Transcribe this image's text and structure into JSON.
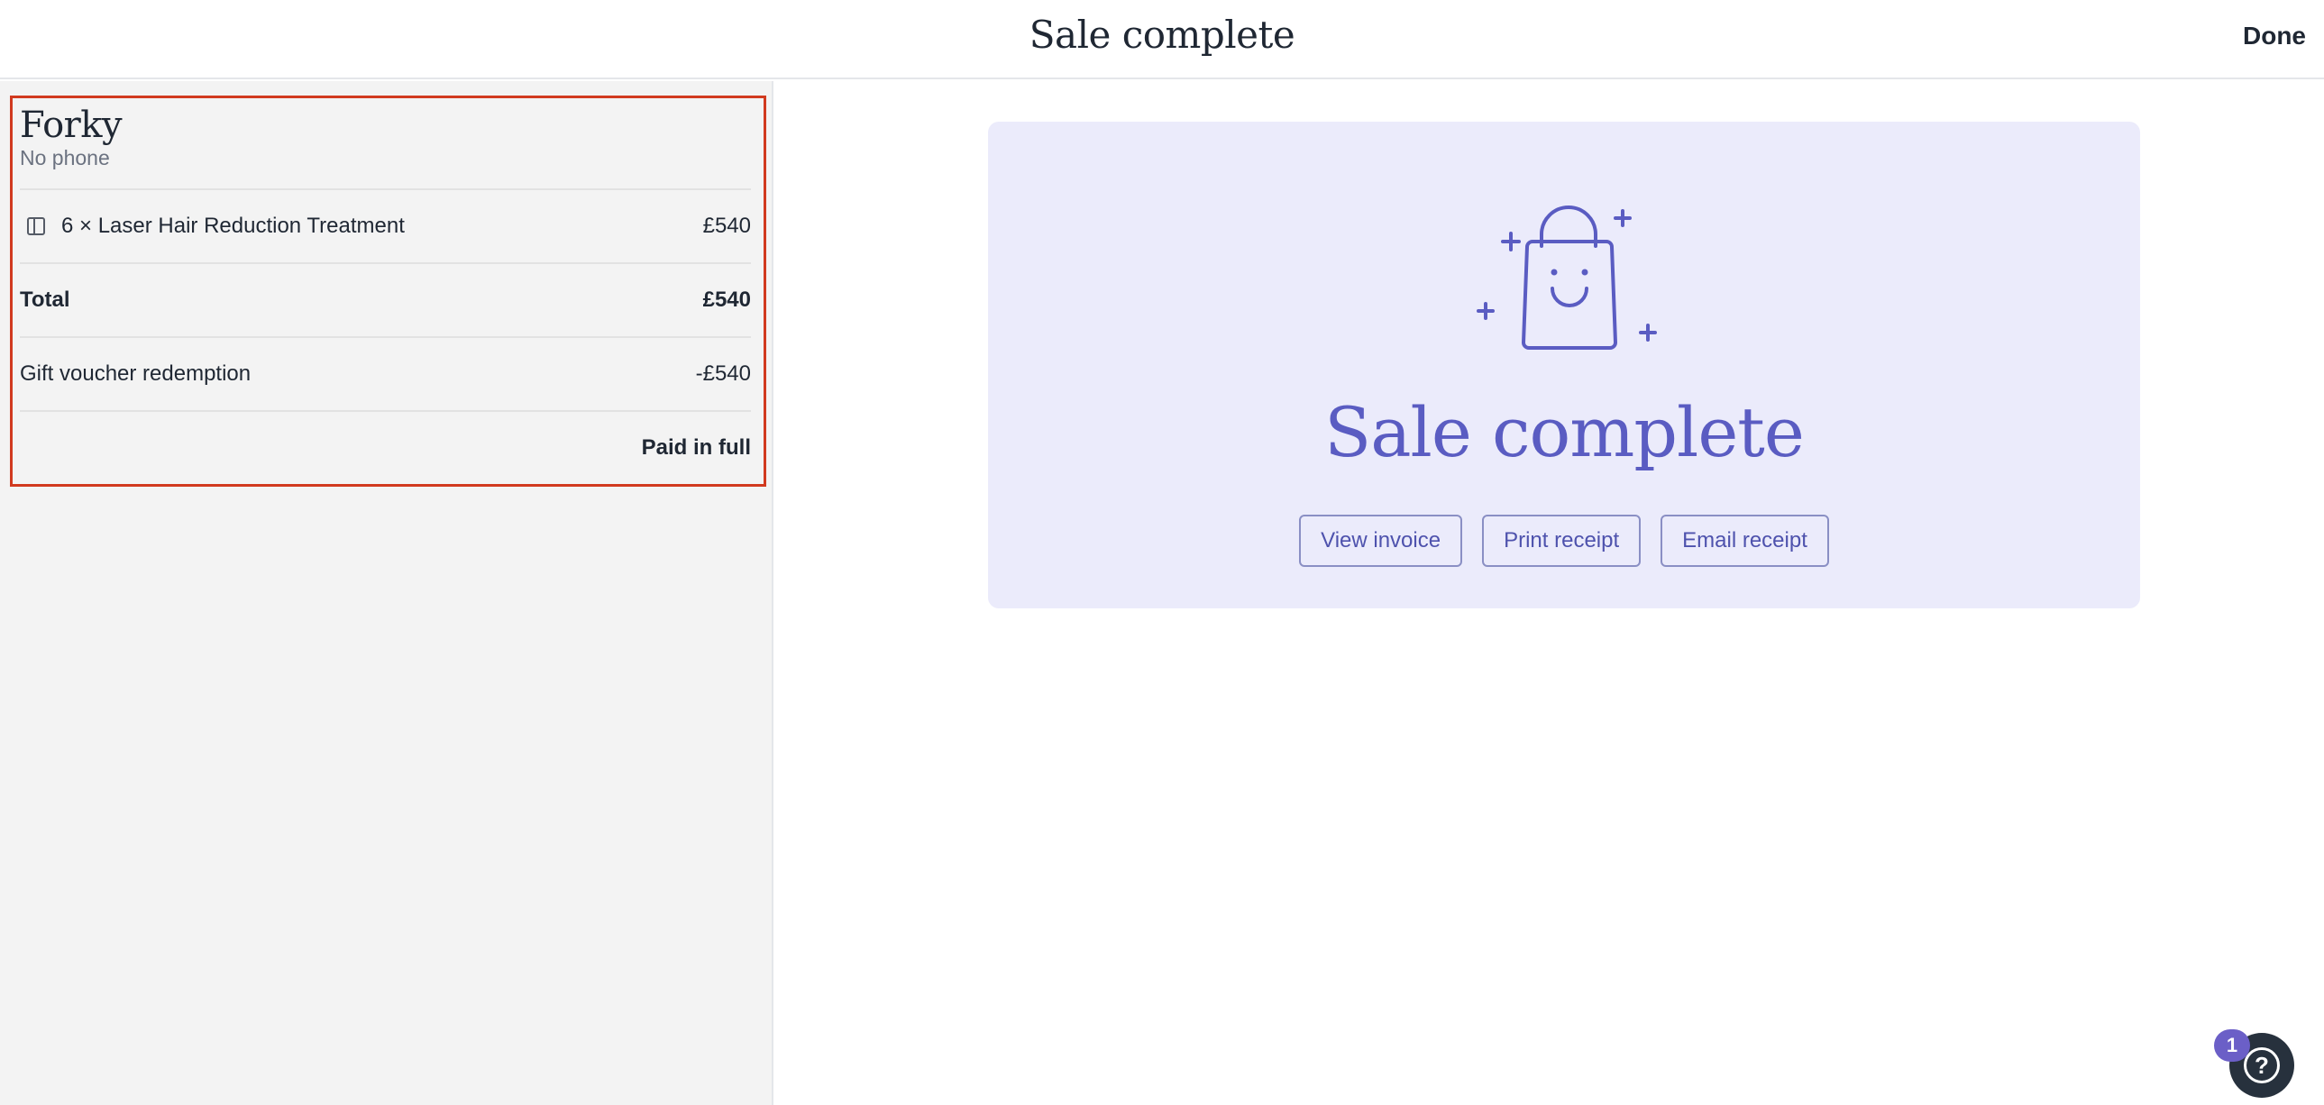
{
  "header": {
    "title": "Sale complete",
    "done_label": "Done"
  },
  "client": {
    "name": "Forky",
    "phone": "No phone"
  },
  "summary": {
    "items": [
      {
        "label": "6 × Laser Hair Reduction Treatment",
        "price": "£540"
      }
    ],
    "total_label": "Total",
    "total_value": "£540",
    "voucher_label": "Gift voucher redemption",
    "voucher_value": "-£540",
    "status": "Paid in full"
  },
  "card": {
    "title": "Sale complete",
    "icon": "shopping-bag-smile-icon",
    "actions": {
      "view_invoice": "View invoice",
      "print_receipt": "Print receipt",
      "email_receipt": "Email receipt"
    }
  },
  "help": {
    "badge_count": "1",
    "icon_glyph": "?"
  },
  "colors": {
    "accent": "#5a5cc2",
    "card_bg": "#ebebfb",
    "highlight_border": "#d13a1f",
    "panel_bg": "#f3f3f3"
  }
}
